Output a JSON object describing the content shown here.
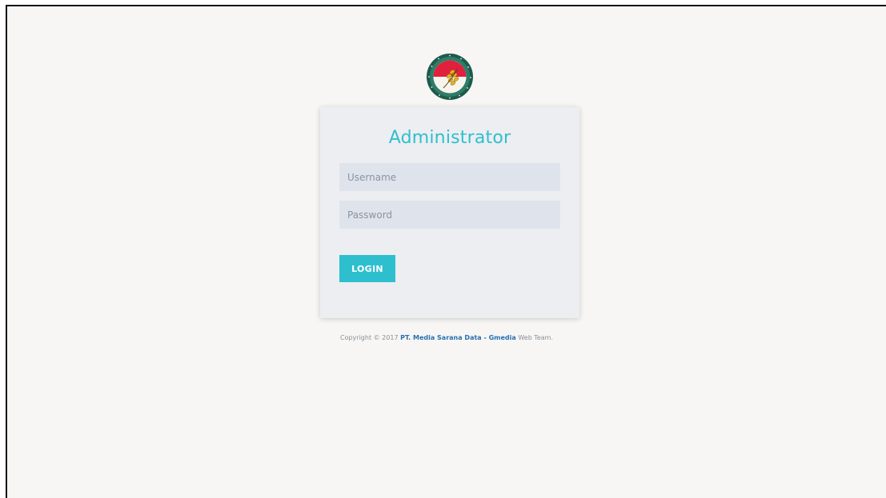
{
  "login": {
    "title": "Administrator",
    "username_placeholder": "Username",
    "password_placeholder": "Password",
    "submit_label": "LOGIN"
  },
  "footer": {
    "prefix": "Copyright © 2017 ",
    "company": "PT. Media Sarana Data - Gmedia",
    "suffix": " Web Team."
  },
  "colors": {
    "accent": "#2ebfcf",
    "background": "#f7f6f4",
    "card": "#edeef1",
    "input": "#dfe4ec",
    "link": "#2a6fb3"
  },
  "icons": {
    "logo": "emblem-logo-icon"
  }
}
